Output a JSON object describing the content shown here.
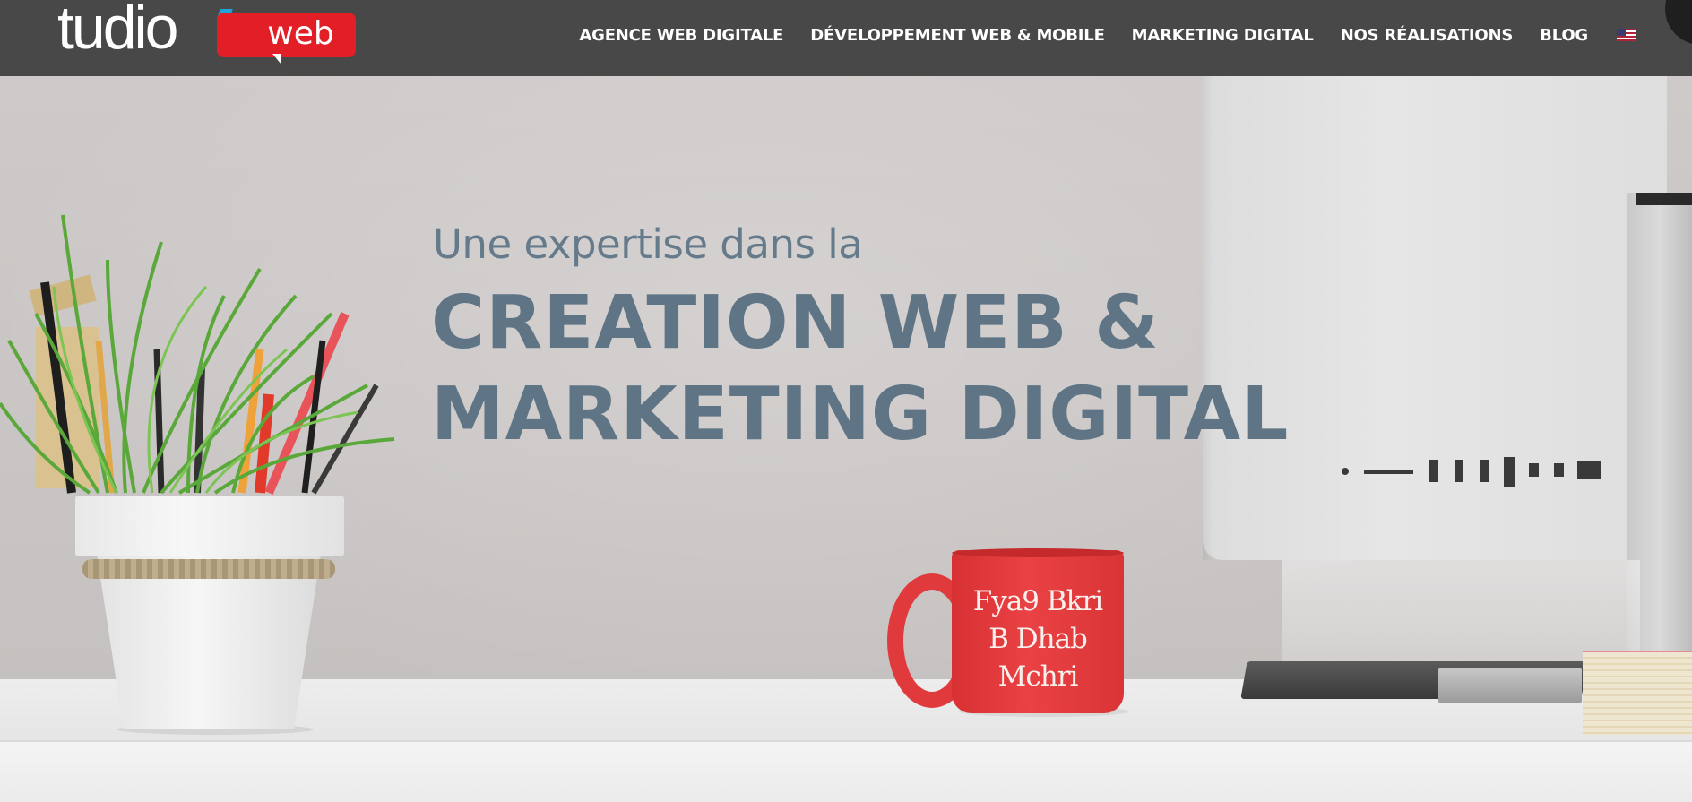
{
  "header": {
    "logo": {
      "text": "tudio",
      "badge": "web"
    },
    "nav": [
      {
        "label": "AGENCE WEB DIGITALE"
      },
      {
        "label": "DÉVELOPPEMENT WEB & MOBILE"
      },
      {
        "label": "MARKETING DIGITAL"
      },
      {
        "label": "NOS RÉALISATIONS"
      },
      {
        "label": "BLOG"
      }
    ],
    "language_flag": "us-flag-icon"
  },
  "hero": {
    "subtitle": "Une expertise dans la",
    "title_line1": "CREATION WEB &",
    "title_line2": "MARKETING DIGITAL"
  },
  "mug": {
    "line1": "Fya9 Bkri",
    "line2": "B Dhab Mchri"
  },
  "colors": {
    "header_bg": "#404040",
    "brand_red": "#e21f26",
    "hero_text": "#5f7585",
    "mug_red": "#e03a3d"
  }
}
